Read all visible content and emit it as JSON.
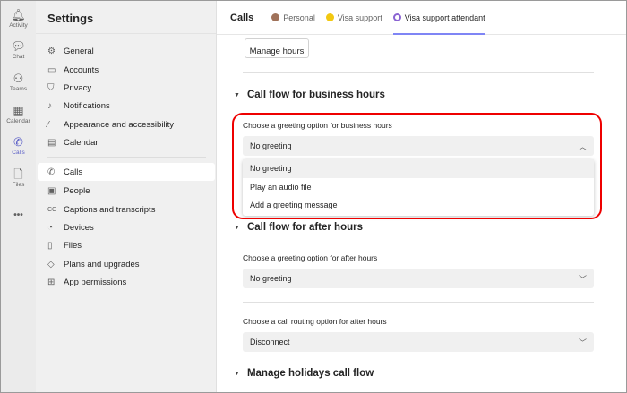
{
  "rail": [
    {
      "label": "Activity",
      "icon": "bell-icon"
    },
    {
      "label": "Chat",
      "icon": "chat-icon"
    },
    {
      "label": "Teams",
      "icon": "teams-icon"
    },
    {
      "label": "Calendar",
      "icon": "calendar-icon"
    },
    {
      "label": "Calls",
      "icon": "phone-icon",
      "active": true
    },
    {
      "label": "Files",
      "icon": "file-icon"
    },
    {
      "label": "•••",
      "icon": "more-icon"
    }
  ],
  "settings": {
    "title": "Settings",
    "items": [
      {
        "label": "General",
        "icon": "gear-icon"
      },
      {
        "label": "Accounts",
        "icon": "id-card-icon"
      },
      {
        "label": "Privacy",
        "icon": "shield-icon"
      },
      {
        "label": "Notifications",
        "icon": "bell-icon"
      },
      {
        "label": "Appearance and accessibility",
        "icon": "wand-icon"
      },
      {
        "label": "Calendar",
        "icon": "calendar-icon"
      },
      {
        "label": "Calls",
        "icon": "phone-icon",
        "selected": true
      },
      {
        "label": "People",
        "icon": "person-icon"
      },
      {
        "label": "Captions and transcripts",
        "icon": "cc-icon"
      },
      {
        "label": "Devices",
        "icon": "headset-icon"
      },
      {
        "label": "Files",
        "icon": "file-icon"
      },
      {
        "label": "Plans and upgrades",
        "icon": "diamond-icon"
      },
      {
        "label": "App permissions",
        "icon": "apps-icon"
      }
    ]
  },
  "header": {
    "title": "Calls",
    "tabs": [
      {
        "label": "Personal",
        "color": "#a0725a"
      },
      {
        "label": "Visa support",
        "color": "#f2c811"
      },
      {
        "label": "Visa support attendant",
        "color": "#8a63d2",
        "active": true
      }
    ]
  },
  "main": {
    "manage_hours": "Manage hours",
    "business": {
      "title": "Call flow for business hours",
      "label": "Choose a greeting option for business hours",
      "value": "No greeting",
      "options": [
        "No greeting",
        "Play an audio file",
        "Add a greeting message"
      ]
    },
    "after": {
      "title": "Call flow for after hours",
      "greeting_label": "Choose a greeting option for after hours",
      "greeting_value": "No greeting",
      "routing_label": "Choose a call routing option for after hours",
      "routing_value": "Disconnect"
    },
    "holidays": {
      "title": "Manage holidays call flow"
    }
  },
  "colors": {
    "accent": "#5b5fc7",
    "highlight": "#e00000"
  }
}
